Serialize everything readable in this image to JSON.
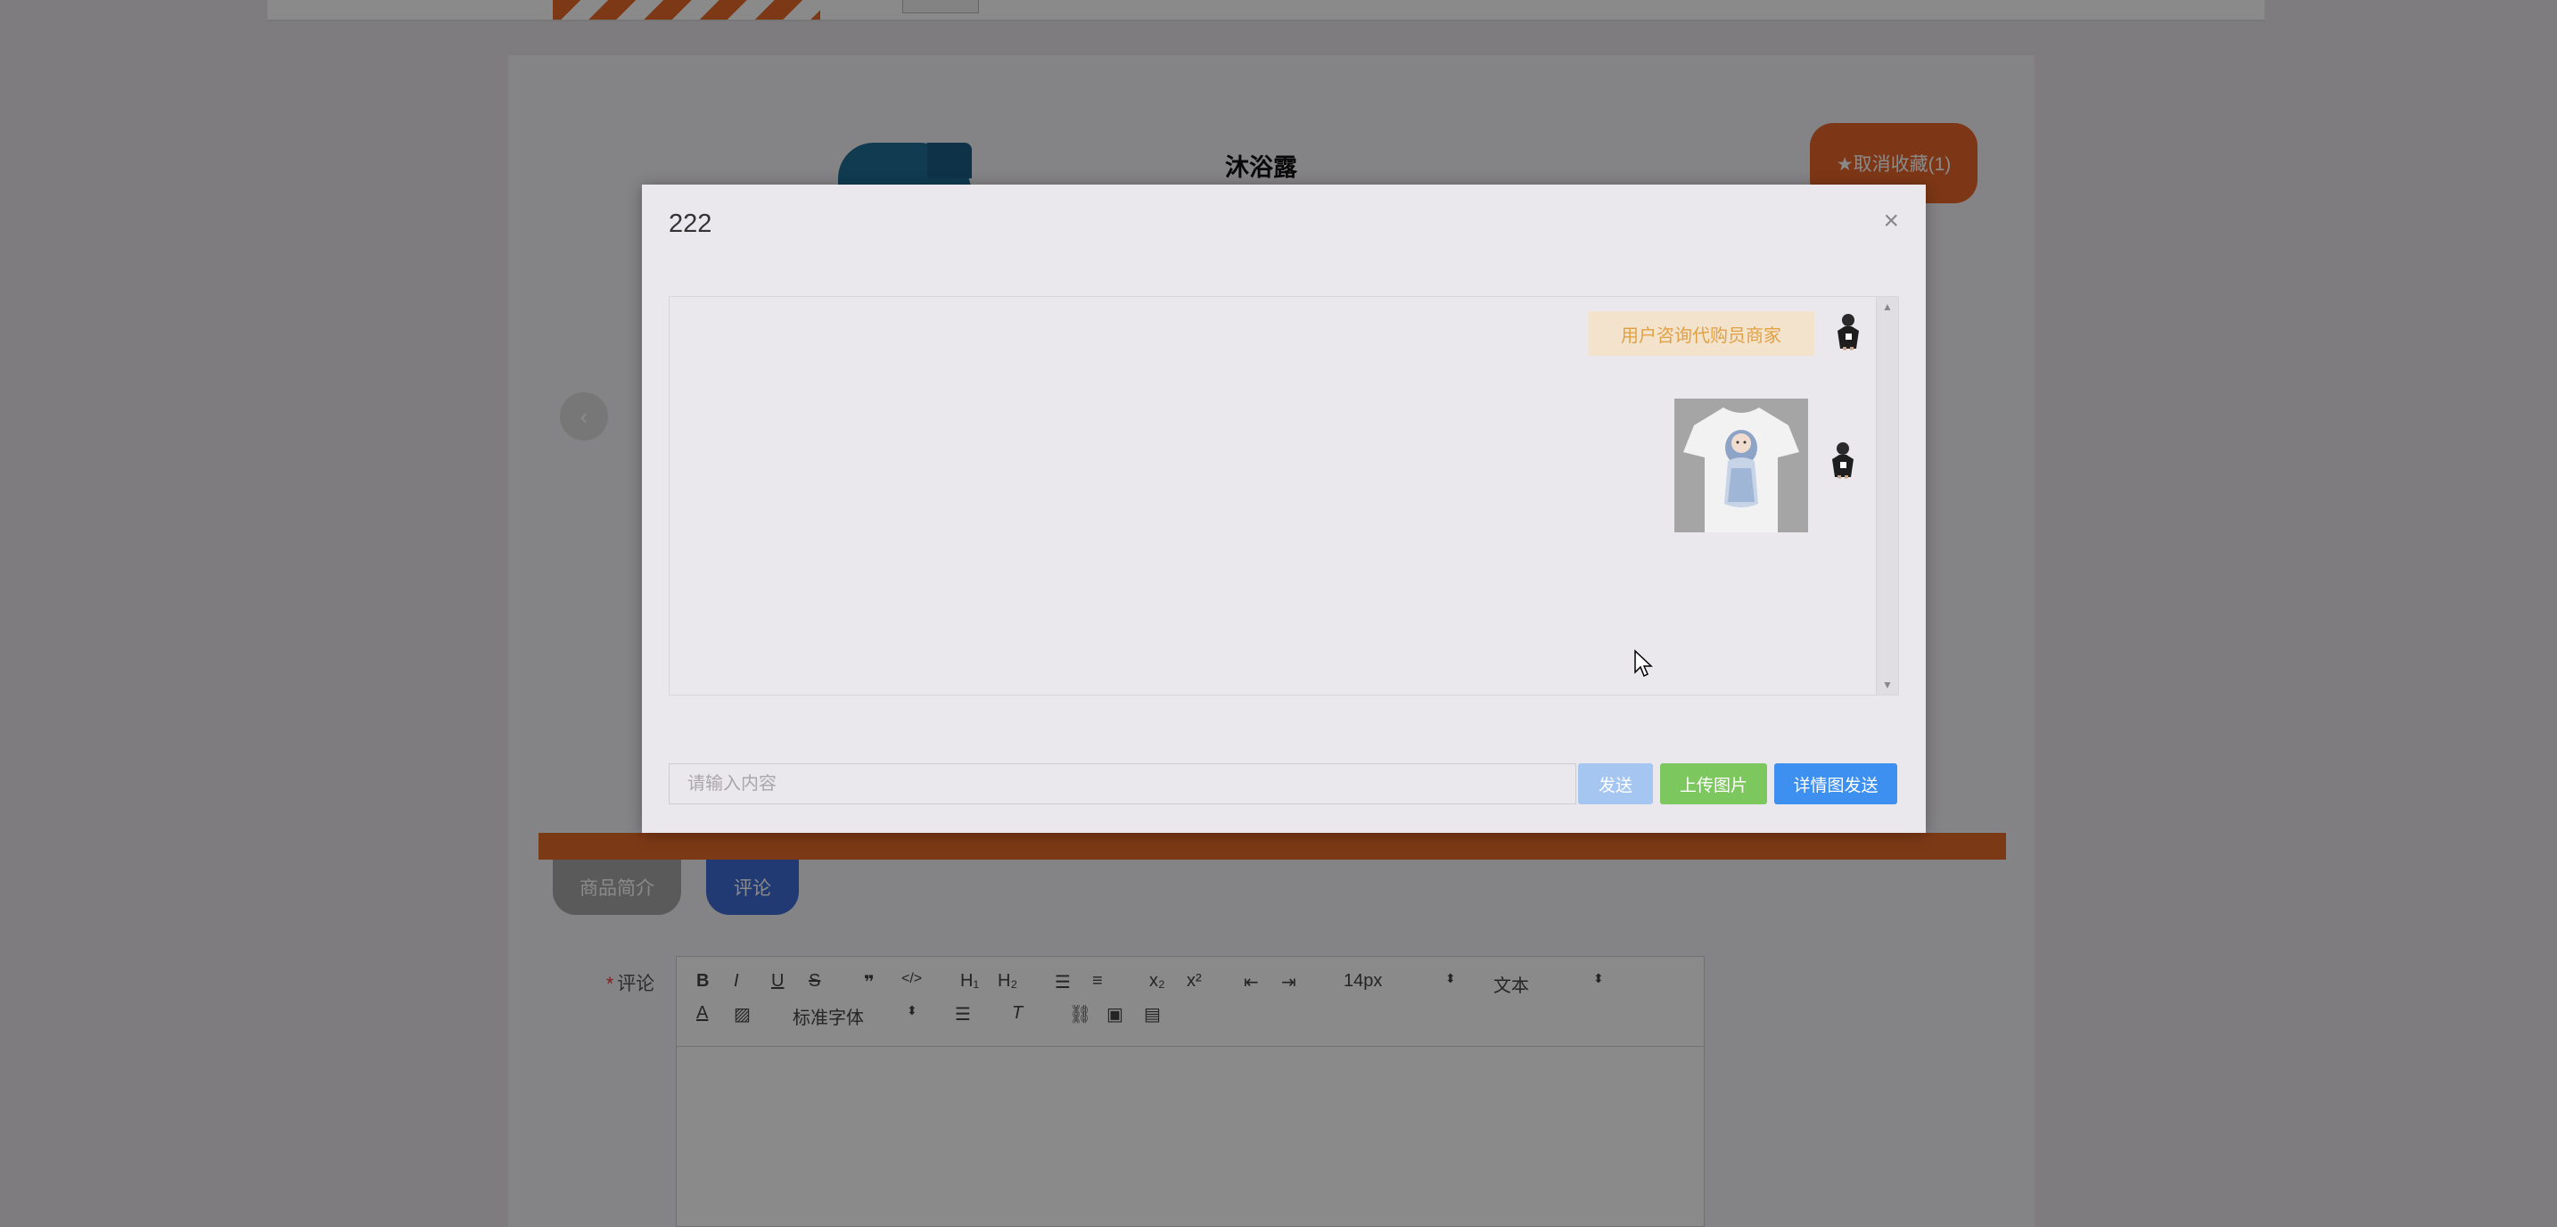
{
  "background_page": {
    "product_title": "沐浴露",
    "favorite_button": "★取消收藏(1)",
    "tabs": [
      {
        "label": "商品简介"
      },
      {
        "label": "评论"
      }
    ],
    "comment_label": "评论",
    "required_mark": "*",
    "editor_toolbar": {
      "font_size": "14px",
      "text_style": "文本",
      "font_family": "标准字体"
    }
  },
  "chat_modal": {
    "title": "222",
    "close_icon": "×",
    "messages": [
      {
        "type": "text",
        "text": "用户咨询代购员商家",
        "side": "right"
      },
      {
        "type": "image",
        "image": "t-shirt-photo",
        "side": "right"
      }
    ],
    "input": {
      "placeholder": "请输入内容",
      "value": ""
    },
    "buttons": {
      "send": "发送",
      "upload_image": "上传图片",
      "detail_send": "详情图发送"
    }
  },
  "colors": {
    "orange_accent": "#e8662a",
    "send_button": "#a6c6f2",
    "upload_button": "#7cc85e",
    "detail_button": "#3d8ff0",
    "active_tab": "#3e6bd7",
    "bubble_bg": "#f4e3cc",
    "bubble_text": "#e0a144"
  }
}
